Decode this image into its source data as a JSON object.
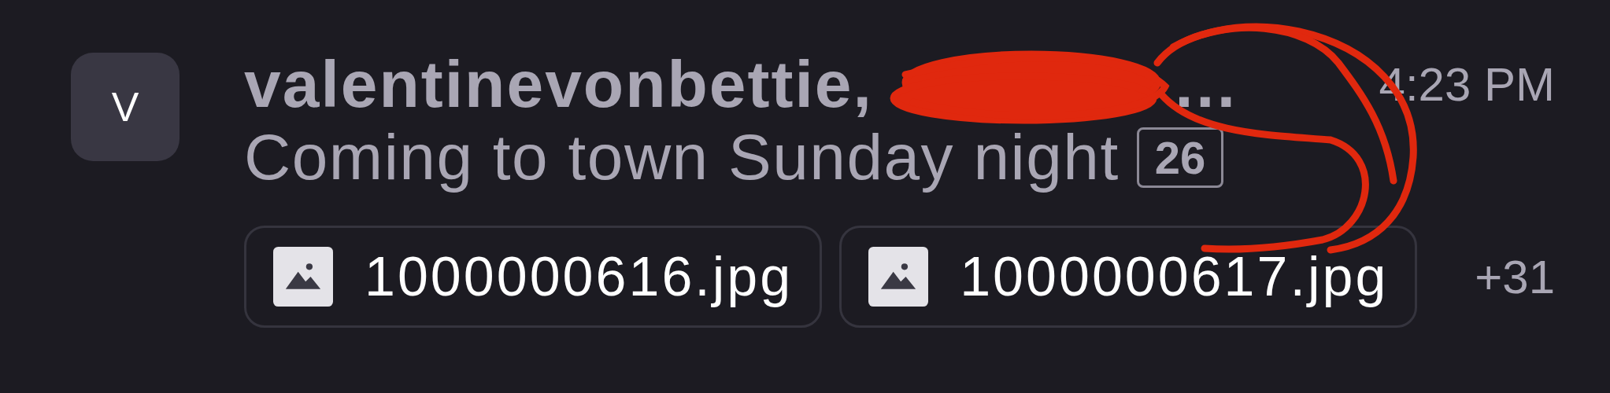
{
  "conversation": {
    "avatar": "V",
    "title": "valentinevonbettie,",
    "title_tail": "…",
    "time": "4:23 PM",
    "preview": "Coming to town Sunday night",
    "count_badge": "26",
    "attachments": [
      {
        "name": "1000000616.jpg"
      },
      {
        "name": "1000000617.jpg"
      }
    ],
    "more_attachments": "+31",
    "redacted": true
  }
}
